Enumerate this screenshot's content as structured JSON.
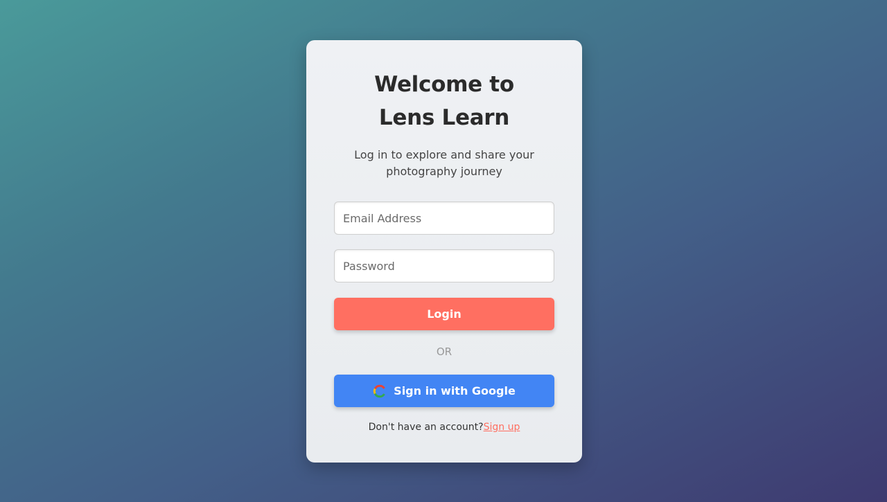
{
  "card": {
    "title_line1": "Welcome to",
    "title_line2": "Lens Learn",
    "subtitle": "Log in to explore and share your photography journey"
  },
  "form": {
    "email_placeholder": "Email Address",
    "email_value": "",
    "password_placeholder": "Password",
    "password_value": "",
    "login_label": "Login",
    "divider_label": "OR",
    "google_label": "Sign in with Google"
  },
  "footer": {
    "prompt": "Don't have an account?",
    "signup_label": "Sign up"
  },
  "icons": {
    "google": "google-icon"
  },
  "colors": {
    "accent": "#ff6f61",
    "google_blue": "#4285f4",
    "card_bg": "#eceff2"
  }
}
